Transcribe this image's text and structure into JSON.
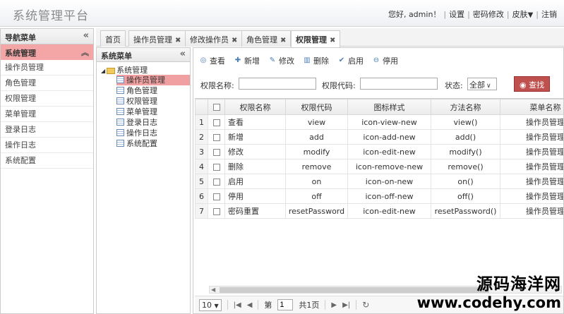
{
  "header": {
    "app_title": "系统管理平台",
    "greeting": "您好, admin！",
    "links": [
      "设置",
      "密码修改",
      "皮肤"
    ],
    "logout": "注销"
  },
  "leftnav": {
    "title": "导航菜单",
    "group": "系统管理",
    "items": [
      "操作员管理",
      "角色管理",
      "权限管理",
      "菜单管理",
      "登录日志",
      "操作日志",
      "系统配置"
    ]
  },
  "tabs": [
    {
      "label": "首页",
      "closable": false
    },
    {
      "label": "操作员管理",
      "closable": true
    },
    {
      "label": "修改操作员",
      "closable": true
    },
    {
      "label": "角色管理",
      "closable": true
    },
    {
      "label": "权限管理",
      "closable": true,
      "active": true
    }
  ],
  "tree": {
    "title": "系统菜单",
    "root": "系统管理",
    "nodes": [
      "操作员管理",
      "角色管理",
      "权限管理",
      "菜单管理",
      "登录日志",
      "操作日志",
      "系统配置"
    ],
    "selected_index": 0
  },
  "toolbar": {
    "view": "查看",
    "add": "新增",
    "edit": "修改",
    "delete": "删除",
    "enable": "启用",
    "disable": "停用"
  },
  "search": {
    "name_label": "权限名称:",
    "code_label": "权限代码:",
    "status_label": "状态:",
    "status_value": "全部",
    "search_button": "查找"
  },
  "grid": {
    "columns": [
      "权限名称",
      "权限代码",
      "图标样式",
      "方法名称",
      "菜单名称"
    ],
    "rows": [
      [
        "查看",
        "view",
        "icon-view-new",
        "view()",
        "操作员管理"
      ],
      [
        "新增",
        "add",
        "icon-add-new",
        "add()",
        "操作员管理"
      ],
      [
        "修改",
        "modify",
        "icon-edit-new",
        "modify()",
        "操作员管理"
      ],
      [
        "删除",
        "remove",
        "icon-remove-new",
        "remove()",
        "操作员管理"
      ],
      [
        "启用",
        "on",
        "icon-on-new",
        "on()",
        "操作员管理"
      ],
      [
        "停用",
        "off",
        "icon-off-new",
        "off()",
        "操作员管理"
      ],
      [
        "密码重置",
        "resetPassword",
        "icon-edit-new",
        "resetPassword()",
        "操作员管理"
      ]
    ]
  },
  "pager": {
    "page_size": "10",
    "page_prefix": "第",
    "page_value": "1",
    "page_total": "共1页"
  },
  "watermark": {
    "line1": "源码海洋网",
    "line2": "www.codehy.com"
  }
}
